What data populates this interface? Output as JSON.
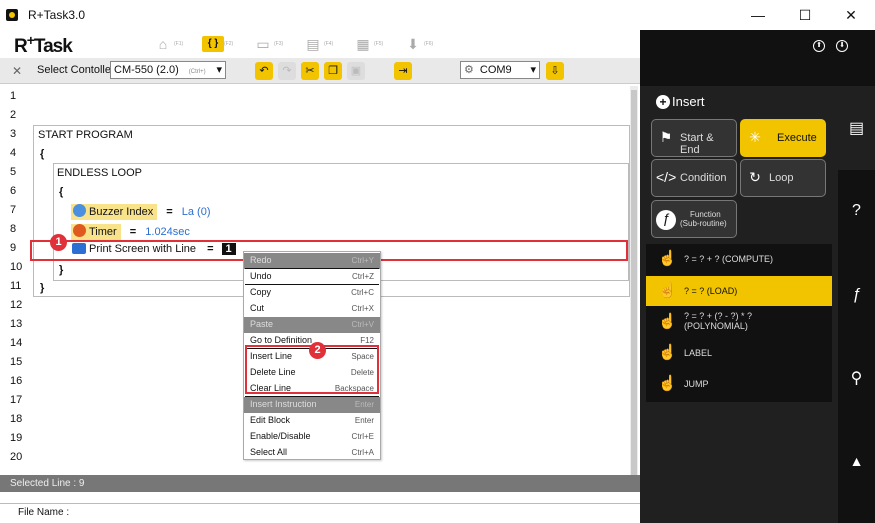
{
  "window": {
    "title": "R+Task3.0",
    "minimize": "—",
    "maximize": "☐",
    "close": "✕"
  },
  "brand": {
    "r": "R",
    "plus": "+",
    "task": "Task"
  },
  "nav": [
    {
      "icon": "home-icon",
      "glyph": "⌂",
      "key": "(F1)"
    },
    {
      "icon": "program-icon",
      "glyph": "{ }",
      "key": "(F2)"
    },
    {
      "icon": "monitor-icon",
      "glyph": "▭",
      "key": "(F3)"
    },
    {
      "icon": "film-icon",
      "glyph": "▤",
      "key": "(F4)"
    },
    {
      "icon": "image-icon",
      "glyph": "▦",
      "key": "(F5)"
    },
    {
      "icon": "download-icon",
      "glyph": "⬇",
      "key": "(F6)"
    }
  ],
  "toolbar": {
    "select_controller_label": "Select Contoller",
    "controller_value": "CM-550 (2.0)",
    "controller_key": "(Ctrl+)",
    "port_value": "COM9",
    "undo": "↶",
    "redo": "↷",
    "cut": "✂",
    "copy": "❐",
    "paste": "▣",
    "exit": "⇥",
    "port_gear": "⚙",
    "port_connect": "⇩"
  },
  "lines": [
    "1",
    "2",
    "3",
    "4",
    "5",
    "6",
    "7",
    "8",
    "9",
    "10",
    "11",
    "12",
    "13",
    "14",
    "15",
    "16",
    "17",
    "18",
    "19",
    "20"
  ],
  "code": {
    "start": "START PROGRAM",
    "open1": "{",
    "loop": "ENDLESS LOOP",
    "open2": "{",
    "buzzer": "Buzzer Index",
    "eq1": "=",
    "buzzer_val": "La (0)",
    "timer": "Timer",
    "eq2": "=",
    "timer_val": "1.024sec",
    "print": "Print Screen with Line",
    "eq3": "=",
    "print_val": "1",
    "close2": "}",
    "close1": "}"
  },
  "badges": {
    "one": "1",
    "two": "2"
  },
  "menu": [
    {
      "label": "Redo",
      "key": "Ctrl+Y",
      "disabled": true
    },
    {
      "label": "Undo",
      "key": "Ctrl+Z",
      "disabled": false
    },
    {
      "label": "Copy",
      "key": "Ctrl+C",
      "disabled": false
    },
    {
      "label": "Cut",
      "key": "Ctrl+X",
      "disabled": false
    },
    {
      "label": "Paste",
      "key": "Ctrl+V",
      "disabled": true
    },
    {
      "label": "Go to Definition",
      "key": "F12",
      "disabled": false
    },
    {
      "label": "Insert Line",
      "key": "Space",
      "disabled": false
    },
    {
      "label": "Delete Line",
      "key": "Delete",
      "disabled": false
    },
    {
      "label": "Clear Line",
      "key": "Backspace",
      "disabled": false
    },
    {
      "label": "Insert Instruction",
      "key": "Enter",
      "disabled": true
    },
    {
      "label": "Edit Block",
      "key": "Enter",
      "disabled": false
    },
    {
      "label": "Enable/Disable",
      "key": "Ctrl+E",
      "disabled": false
    },
    {
      "label": "Select All",
      "key": "Ctrl+A",
      "disabled": false
    }
  ],
  "status": {
    "selected_line": "Selected Line : 9",
    "file_name": "File Name :"
  },
  "insert_panel": {
    "title": "Insert",
    "buttons": [
      {
        "label": "Start & End",
        "icon": "flag-icon",
        "glyph": "⚑",
        "active": false
      },
      {
        "label": "Execute",
        "icon": "spinner-icon",
        "glyph": "✳",
        "active": true
      },
      {
        "label": "Condition",
        "icon": "code-icon",
        "glyph": "</>",
        "active": false
      },
      {
        "label": "Loop",
        "icon": "loop-icon",
        "glyph": "↻",
        "active": false
      },
      {
        "label": "Function\n(Sub-routine)",
        "label1": "Function",
        "label2": "(Sub-routine)",
        "icon": "function-icon",
        "glyph": "ƒ",
        "active": false
      }
    ],
    "items": [
      {
        "label": "? = ? + ?  (COMPUTE)",
        "active": false
      },
      {
        "label": "? = ?  (LOAD)",
        "active": true
      },
      {
        "label1": "? = ? + (? - ?) * ?",
        "label2": "(POLYNOMIAL)",
        "active": false
      },
      {
        "label": "LABEL",
        "active": false
      },
      {
        "label": "JUMP",
        "active": false
      }
    ]
  },
  "sidebar": {
    "chat": "▤",
    "help": "?",
    "function": "ƒ",
    "search": "⚲",
    "warning": "▲"
  },
  "top_buttons": {
    "upload": "⬆",
    "download": "⬇"
  }
}
